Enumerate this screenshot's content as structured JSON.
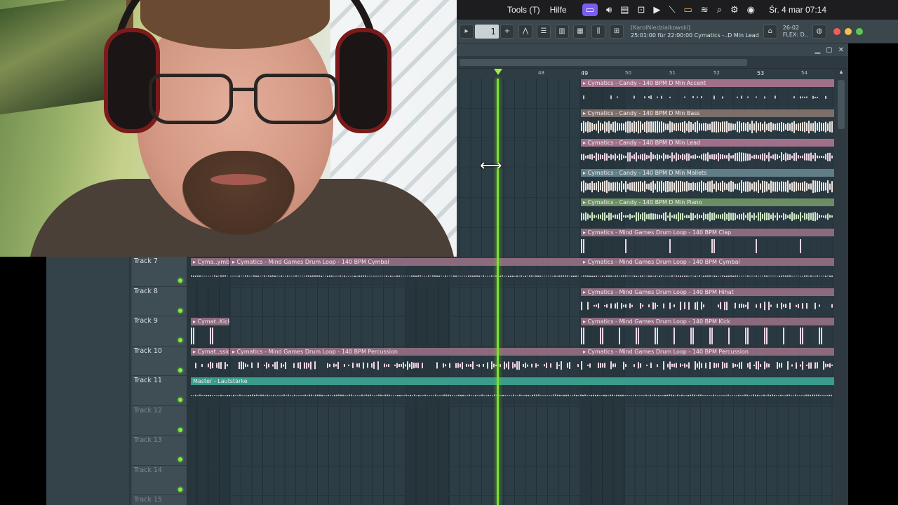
{
  "menubar": {
    "items": [
      "Tools (T)",
      "Hilfe"
    ],
    "clock": "Śr. 4 mar  07:14"
  },
  "toolbar": {
    "pattern_number": "1",
    "hint_user": "[KarolNiedzialkowski]",
    "hint_text": "25:01:00 für 22:00:00 Cymatics -..D Min Lead",
    "flex_date": "26-02",
    "flex_label": "FLEX: D.."
  },
  "timeline": {
    "bars": [
      "48",
      "49",
      "50",
      "51",
      "52",
      "53",
      "54"
    ]
  },
  "tracks": [
    {
      "name": "Track 7",
      "active": true
    },
    {
      "name": "Track 8",
      "active": true
    },
    {
      "name": "Track 9",
      "active": true
    },
    {
      "name": "Track 10",
      "active": true
    },
    {
      "name": "Track 11",
      "active": true
    },
    {
      "name": "Track 12",
      "active": false
    },
    {
      "name": "Track 13",
      "active": false
    },
    {
      "name": "Track 14",
      "active": false
    },
    {
      "name": "Track 15",
      "active": false
    }
  ],
  "clips": {
    "accent": "▸ Cymatics - Candy - 140 BPM D Min Accent",
    "bass": "▸ Cymatics - Candy - 140 BPM D Min Bass",
    "lead": "▸ Cymatics - Candy - 140 BPM D Min Lead",
    "mallets": "▸ Cymatics - Candy - 140 BPM D Min Mallets",
    "piano": "▸ Cymatics - Candy - 140 BPM D Min Piano",
    "clap": "▸ Cymatics - Mind Games Drum Loop - 140 BPM Clap",
    "cymbal_short": "▸ Cyma..ymbal",
    "cymbal": "▸ Cymatics -  Mind Games Drum Loop - 140 BPM Cymbal",
    "hihat": "▸ Cymatics -  Mind Games Drum Loop - 140 BPM Hihat",
    "kick_short": "▸ Cymat..Kick",
    "kick": "▸ Cymatics -  Mind Games Drum Loop - 140 BPM Kick",
    "perc_short": "▸ Cymat..ssion",
    "perc": "▸ Cymatics -  Mind Games Drum Loop - 140 BPM Percussion",
    "master": "Master - Lautstärke"
  },
  "colors": {
    "accent": "#a0708a",
    "bass": "#7c6f6a",
    "lead": "#a0708a",
    "mallets": "#5f7e86",
    "piano": "#6b8e64",
    "drum": "#8c6a7e",
    "master": "#3a9c8c",
    "playhead": "#7ae22e"
  }
}
